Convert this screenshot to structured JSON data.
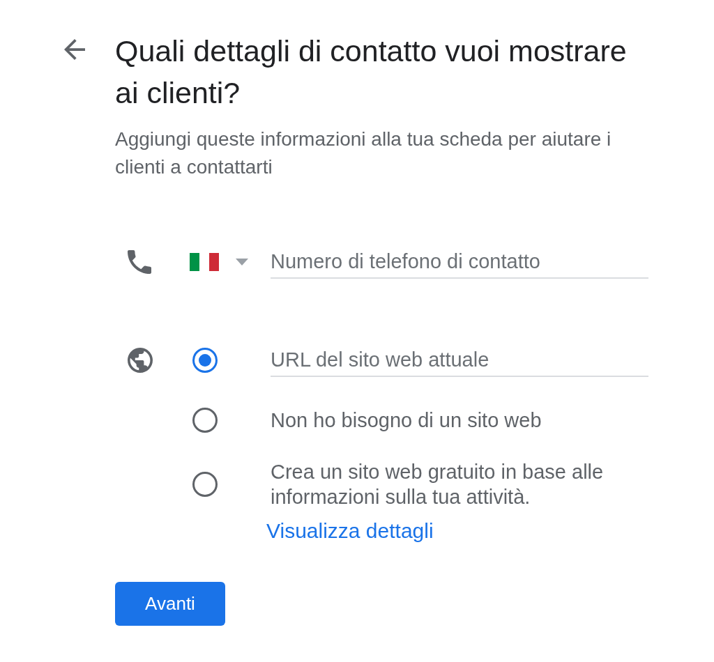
{
  "header": {
    "title": "Quali dettagli di contatto vuoi mostrare ai clienti?",
    "subtitle": "Aggiungi queste informazioni alla tua scheda per aiutare i clienti a contattarti"
  },
  "phone": {
    "placeholder": "Numero di telefono di contatto"
  },
  "website": {
    "options": [
      {
        "kind": "input",
        "placeholder": "URL del sito web attuale",
        "selected": true
      },
      {
        "kind": "text",
        "label": "Non ho bisogno di un sito web",
        "selected": false
      },
      {
        "kind": "text",
        "label": "Crea un sito web gratuito in base alle informazioni sulla tua attività.",
        "link": "Visualizza dettagli",
        "selected": false
      }
    ]
  },
  "buttons": [
    {
      "label": "Avanti"
    }
  ]
}
